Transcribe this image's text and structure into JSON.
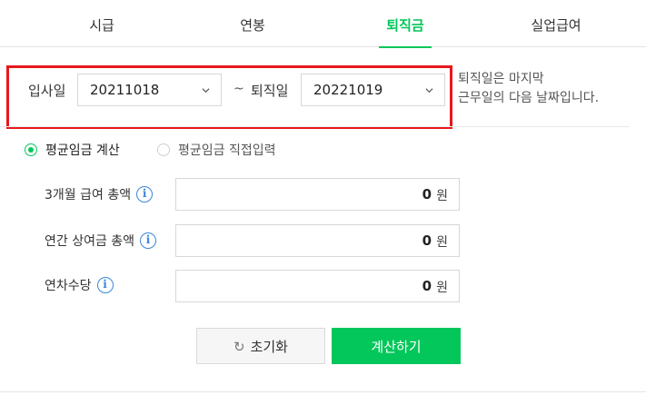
{
  "tabs": [
    {
      "label": "시급"
    },
    {
      "label": "연봉"
    },
    {
      "label": "퇴직금"
    },
    {
      "label": "실업급여"
    }
  ],
  "active_tab": "퇴직금",
  "dates": {
    "hire_label": "입사일",
    "hire_value": "20211018",
    "separator": "~",
    "leave_label": "퇴직일",
    "leave_value": "20221019",
    "note_line1": "퇴직일은 마지막",
    "note_line2": "근무일의 다음 날짜입니다."
  },
  "radios": {
    "option1": "평균임금 계산",
    "option2": "평균임금 직접입력",
    "selected": "option1"
  },
  "fields": [
    {
      "label": "3개월 급여 총액",
      "value": "0",
      "unit": "원"
    },
    {
      "label": "연간 상여금 총액",
      "value": "0",
      "unit": "원"
    },
    {
      "label": "연차수당",
      "value": "0",
      "unit": "원"
    }
  ],
  "buttons": {
    "reset_label": "초기화",
    "calc_label": "계산하기"
  },
  "colors": {
    "accent": "#03c75a",
    "highlight": "#e8171c",
    "info": "#3a86d8"
  }
}
